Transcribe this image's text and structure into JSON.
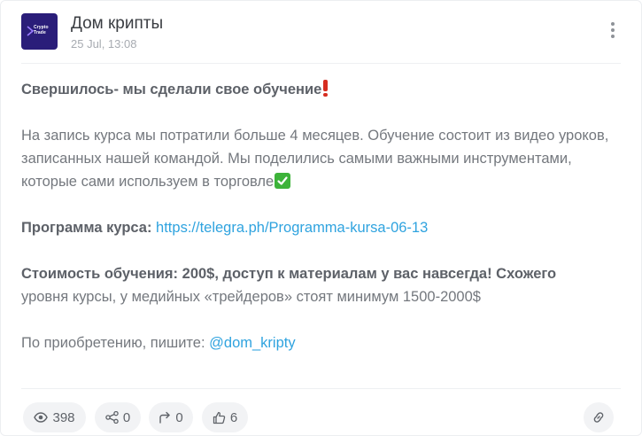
{
  "channel": {
    "name": "Дом крипты",
    "date": "25 Jul, 13:08",
    "logo_text_1": "Crypto",
    "logo_text_2": "Trade"
  },
  "post": {
    "headline": "Свершилось- мы сделали свое обучение",
    "paragraph_1": "На запись курса мы потратили больше 4 месяцев. Обучение состоит из видео уроков, записанных нашей командой. Мы поделились самыми важными инструментами, которые сами используем в торговле",
    "program_label": "Программа курса:",
    "program_link": "https://telegra.ph/Programma-kursa-06-13",
    "price_bold": "Стоимость обучения: 200$, доступ к материалам у вас навсегда! Схожего",
    "price_rest": "уровня курсы, у медийных «трейдеров» стоят минимум 1500-2000$",
    "contact_label": "По приобретению, пишите:",
    "contact_handle": "@dom_kripty"
  },
  "stats": {
    "views": "398",
    "shares": "0",
    "forwards": "0",
    "likes": "6"
  },
  "icons": {
    "menu": "vertical-dots-icon",
    "views": "eye-icon",
    "shares": "share-nodes-icon",
    "forwards": "forward-arrow-icon",
    "likes": "thumbs-up-icon",
    "link": "chain-link-icon"
  },
  "colors": {
    "avatar_bg": "#2a1d79",
    "link": "#2fa3df",
    "pill_bg": "#f2f3f5"
  }
}
